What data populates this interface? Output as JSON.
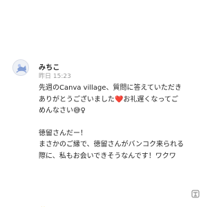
{
  "message": {
    "author": "みちこ",
    "timestamp": "昨日 15:23",
    "paragraphs": [
      "先週のCanva village、質問に答えていただき",
      "ありがとうございました",
      "お礼遅くなってご",
      "めんなさい",
      "徳留さんだー！",
      "まさかのご縁で、徳留さんがバンコク来られる",
      "際に、私もお会いできそうなんです！ワクワ"
    ],
    "emojis": {
      "heart": "❤️",
      "sweat": "😅",
      "female": "♀",
      "sparkles": "✨"
    },
    "icons": {
      "avatar": "user-avatar-icon",
      "translate": "translate-icon",
      "sparkles": "sparkles-icon"
    },
    "colors": {
      "heart": "#e0313a",
      "text": "#222222",
      "muted": "#9a9a9a"
    }
  }
}
